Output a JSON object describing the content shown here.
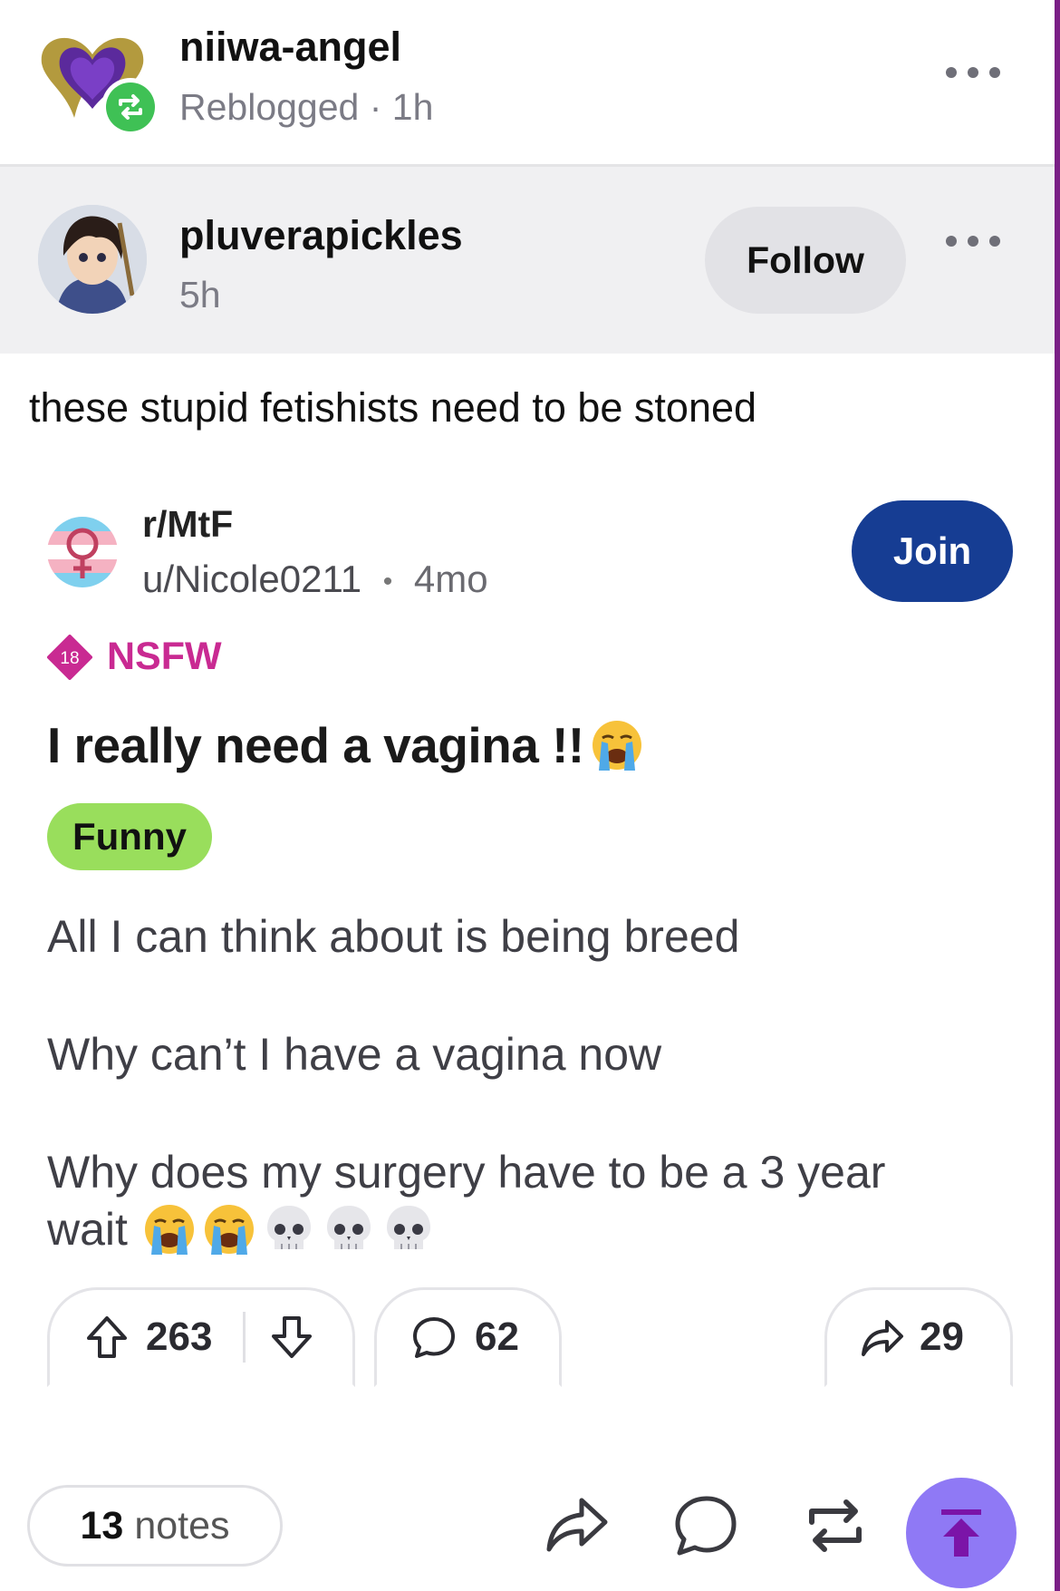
{
  "reblog": {
    "username": "niiwa-angel",
    "meta": "Reblogged · 1h"
  },
  "original_post": {
    "username": "pluverapickles",
    "time": "5h",
    "follow_label": "Follow",
    "comment": "these stupid fetishists need to be stoned"
  },
  "reddit": {
    "subreddit": "r/MtF",
    "user": "u/Nicole0211",
    "separator": "•",
    "age": "4mo",
    "join_label": "Join",
    "nsfw_age": "18",
    "nsfw_label": "NSFW",
    "title": "I really need a vagina !!",
    "title_emoji": "loudly-crying-face",
    "flair": "Funny",
    "body": [
      "All I can think about is being breed",
      "Why can’t I have a vagina now",
      "Why does my surgery have to be a 3 year",
      "wait"
    ],
    "body_emojis": [
      "loudly-crying-face",
      "loudly-crying-face",
      "skull",
      "skull",
      "skull"
    ],
    "upvotes": "263",
    "comments": "62",
    "shares": "29"
  },
  "footer": {
    "notes_count": "13",
    "notes_label": "notes"
  },
  "icons": [
    "more-icon",
    "reblog-icon",
    "upvote-icon",
    "downvote-icon",
    "comment-icon",
    "share-icon",
    "scroll-to-top-icon"
  ],
  "colors": {
    "join": "#163d93",
    "nsfw": "#c92a92",
    "flair": "#99de5c",
    "reblog_badge": "#3fc155",
    "scroll_top": "#8f79f5"
  }
}
